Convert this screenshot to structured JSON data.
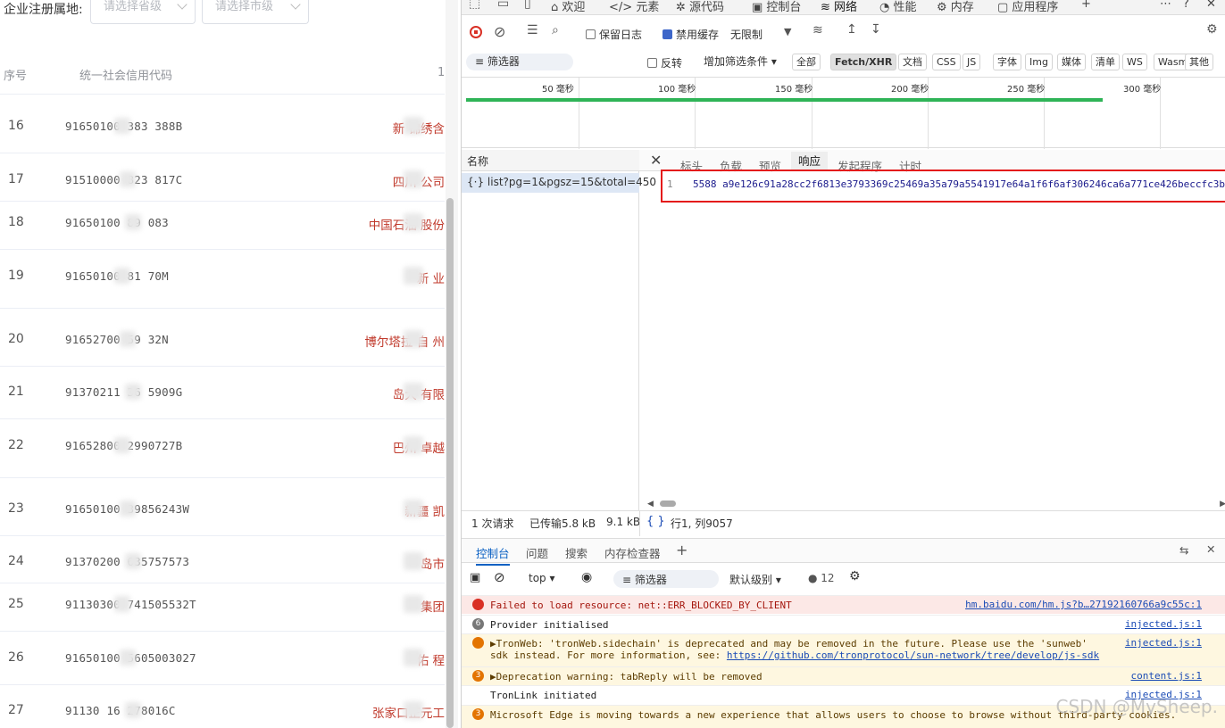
{
  "left_page": {
    "filter_label": "企业注册属地:",
    "province_placeholder": "请选择省级",
    "city_placeholder": "请选择市级",
    "col_index": "序号",
    "col_code": "统一社会信用代码",
    "col_extra": "1",
    "rows": [
      {
        "index": "16",
        "code": "91650100   383   388B",
        "name": "新   锦绣含"
      },
      {
        "index": "17",
        "code": "91510000   823   817C",
        "name": "四川  公司"
      },
      {
        "index": "18",
        "code": "91650100   89   083",
        "name": "中国石油  股份"
      },
      {
        "index": "19",
        "code": "91650100  81   70M",
        "name": "新  业"
      },
      {
        "index": "20",
        "code": "91652700   59   32N",
        "name": "博尔塔拉   自  州"
      },
      {
        "index": "21",
        "code": "91370211   36   5909G",
        "name": "岛大  有限"
      },
      {
        "index": "22",
        "code": "91652800   2990727B",
        "name": "巴州  卓越"
      },
      {
        "index": "23",
        "code": "91650100   39856243W",
        "name": "新疆  凯"
      },
      {
        "index": "24",
        "code": "91370200   635757573",
        "name": "岛市"
      },
      {
        "index": "25",
        "code": "91130300   741505532T",
        "name": "集团"
      },
      {
        "index": "26",
        "code": "91650100   5605003027",
        "name": "佑  程"
      },
      {
        "index": "27",
        "code": "91130   16   278016C",
        "name": "张家口正元工"
      }
    ]
  },
  "devtools": {
    "top_tabs": [
      "欢迎",
      "元素",
      "源代码",
      "控制台",
      "网络",
      "性能",
      "内存",
      "应用程序"
    ],
    "active_tab": "网络",
    "toolbar": {
      "preserve_log": "保留日志",
      "disable_cache": "禁用缓存",
      "throttle": "无限制"
    },
    "filter": {
      "placeholder": "筛选器",
      "invert": "反转",
      "more_filters": "增加筛选条件",
      "types": [
        "全部",
        "Fetch/XHR",
        "文档",
        "CSS",
        "JS",
        "字体",
        "Img",
        "媒体",
        "清单",
        "WS",
        "Wasm",
        "其他"
      ],
      "active_type": "Fetch/XHR"
    },
    "timeline_ticks": [
      "50 毫秒",
      "100 毫秒",
      "150 毫秒",
      "200 毫秒",
      "250 毫秒",
      "300 毫秒"
    ],
    "requests_header": "名称",
    "request_item": "list?pg=1&pgsz=15&total=450",
    "detail_tabs": [
      "标头",
      "负载",
      "预览",
      "响应",
      "发起程序",
      "计时"
    ],
    "active_detail_tab": "响应",
    "response": {
      "line_no": "1",
      "text": "5588 a9e126c91a28cc2f6813e3793369c25469a35a79a5541917e64a1f6f6af306246ca6a771ce426beccfc3b"
    },
    "status": {
      "requests": "1 次请求",
      "transferred": "已传输5.8 kB",
      "resources": "9.1 kB",
      "cursor": "行1, 列9057",
      "braces": "{ }"
    },
    "drawer_tabs": [
      "控制台",
      "问题",
      "搜索",
      "内存检查器"
    ],
    "console_toolbar": {
      "context": "top",
      "filter": "筛选器",
      "level": "默认级别",
      "issues": "12"
    },
    "console": [
      {
        "type": "err",
        "badge": "",
        "text": "Failed to load resource: net::ERR_BLOCKED_BY_CLIENT",
        "src": "hm.baidu.com/hm.js?b…27192160766a9c55c:1"
      },
      {
        "type": "info",
        "badge": "6",
        "text": "Provider initialised",
        "src": "injected.js:1"
      },
      {
        "type": "warn",
        "badge": "",
        "text": "▶TronWeb: 'tronWeb.sidechain' is deprecated and may be removed in the future. Please use the 'sunweb'",
        "text2": "sdk instead. For more information, see: ",
        "link": "https://github.com/tronprotocol/sun-network/tree/develop/js-sdk",
        "src": "injected.js:1"
      },
      {
        "type": "warn",
        "badge": "3",
        "text": "▶Deprecation warning: tabReply will be removed",
        "src": "content.js:1"
      },
      {
        "type": "info",
        "badge": "",
        "text": "TronLink initiated",
        "src": "injected.js:1"
      },
      {
        "type": "warn",
        "badge": "3",
        "text": "Microsoft Edge is moving towards a new experience that allows users to choose to browse without third-party cookies.",
        "src": ""
      }
    ],
    "watermark": "CSDN @MySheep."
  }
}
